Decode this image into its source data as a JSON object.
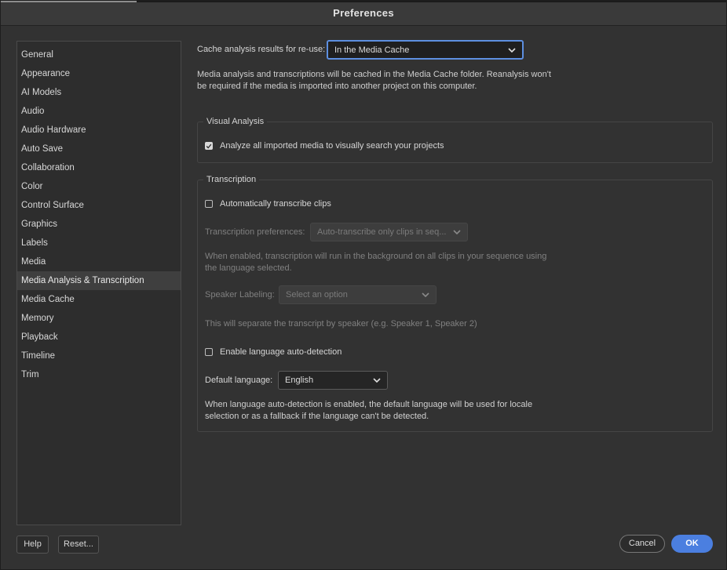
{
  "window": {
    "title": "Preferences"
  },
  "sidebar": {
    "items": [
      {
        "label": "General"
      },
      {
        "label": "Appearance"
      },
      {
        "label": "AI Models"
      },
      {
        "label": "Audio"
      },
      {
        "label": "Audio Hardware"
      },
      {
        "label": "Auto Save"
      },
      {
        "label": "Collaboration"
      },
      {
        "label": "Color"
      },
      {
        "label": "Control Surface"
      },
      {
        "label": "Graphics"
      },
      {
        "label": "Labels"
      },
      {
        "label": "Media"
      },
      {
        "label": "Media Analysis & Transcription",
        "selected": true
      },
      {
        "label": "Media Cache"
      },
      {
        "label": "Memory"
      },
      {
        "label": "Playback"
      },
      {
        "label": "Timeline"
      },
      {
        "label": "Trim"
      }
    ]
  },
  "cache": {
    "label": "Cache analysis results for re-use:",
    "value": "In the Media Cache",
    "desc_line1": "Media analysis and transcriptions will be cached in the Media Cache folder. Reanalysis won't",
    "desc_line2": "be required if the media is imported into another project on this computer."
  },
  "visual_analysis": {
    "title": "Visual Analysis",
    "checkbox_label": "Analyze all imported media to visually search your projects",
    "checked": true
  },
  "transcription": {
    "title": "Transcription",
    "auto_label": "Automatically transcribe clips",
    "auto_checked": false,
    "prefs_label": "Transcription preferences:",
    "prefs_value": "Auto-transcribe only clips in seq...",
    "prefs_desc_line1": "When enabled, transcription will run in the background on all clips in your sequence using",
    "prefs_desc_line2": "the language selected.",
    "speaker_label": "Speaker Labeling:",
    "speaker_placeholder": "Select an option",
    "speaker_desc": "This will separate the transcript by speaker (e.g. Speaker 1, Speaker 2)",
    "lang_detect_label": "Enable language auto-detection",
    "lang_detect_checked": false,
    "default_lang_label": "Default language:",
    "default_lang_value": "English",
    "lang_desc_line1": "When language auto-detection is enabled, the default language will be used for locale",
    "lang_desc_line2": "selection or as a fallback if the language can't be detected."
  },
  "footer": {
    "help": "Help",
    "reset": "Reset...",
    "cancel": "Cancel",
    "ok": "OK"
  },
  "colors": {
    "accent": "#4b7fe0"
  }
}
